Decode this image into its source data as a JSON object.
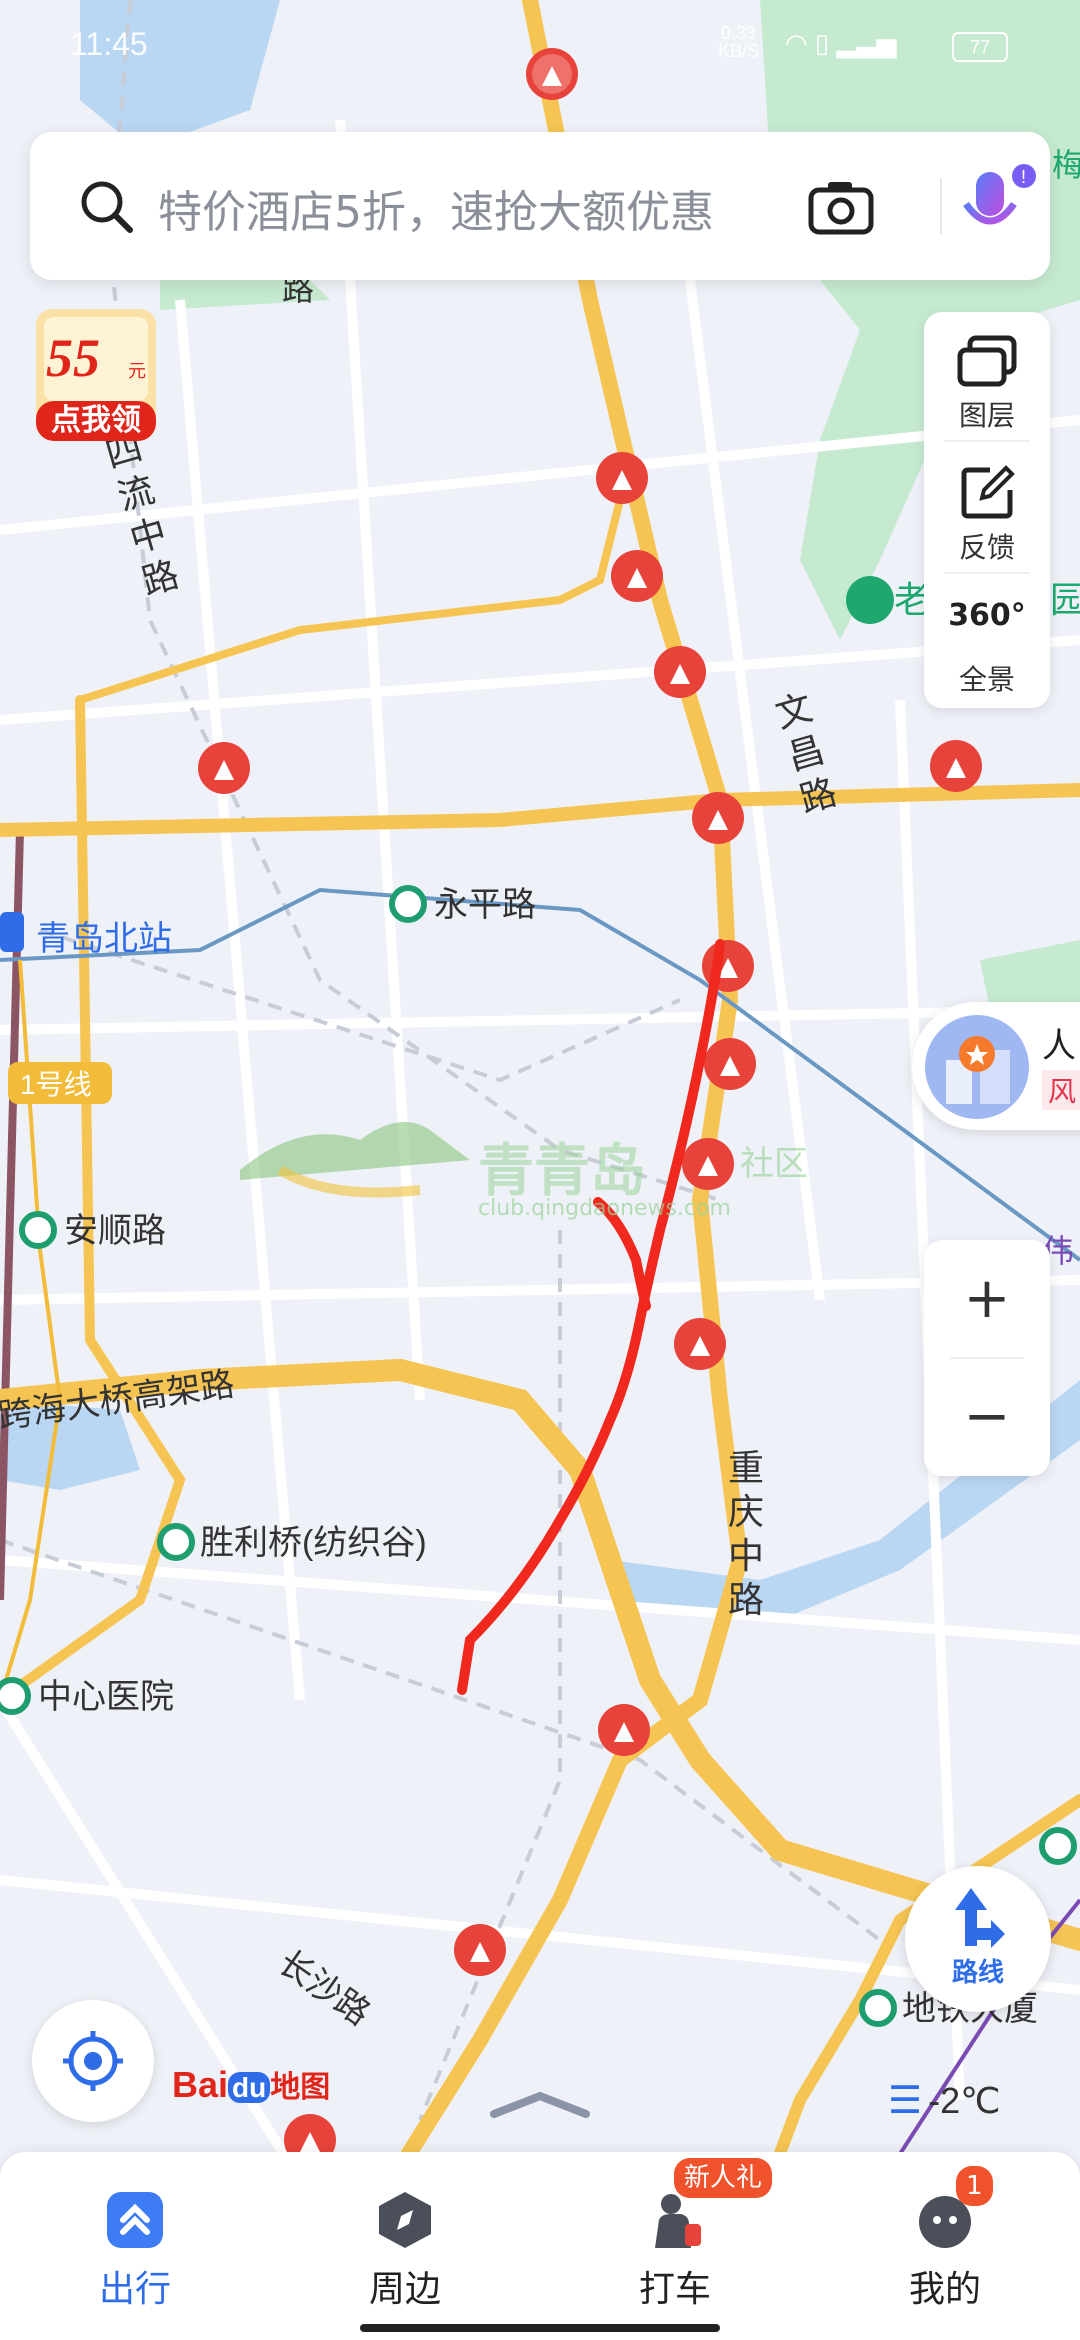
{
  "status_bar": {
    "time": "11:45",
    "net_speed": "0.33",
    "net_unit": "KB/S",
    "battery": "77"
  },
  "search": {
    "placeholder": "特价酒店5折，速抢大额优惠"
  },
  "coupon": {
    "amount": "55",
    "unit": "元",
    "button": "点我领"
  },
  "map_tools": {
    "layers": "图层",
    "feedback": "反馈",
    "panorama_badge": "360°",
    "panorama": "全景"
  },
  "zoom": {
    "in": "+",
    "out": "−"
  },
  "poi_card": {
    "title": "人",
    "tag": "风"
  },
  "map_labels": {
    "roads": [
      "四流中路",
      "文昌路",
      "跨海大桥高架路",
      "重庆中路",
      "长沙路",
      "路",
      "梅",
      "老",
      "园",
      "伟"
    ],
    "stations": [
      "永平路",
      "青岛北站",
      "安顺路",
      "胜利桥(纺织谷)",
      "中心医院",
      "地铁大厦"
    ],
    "line": "1号线"
  },
  "watermark": {
    "title": "青青岛",
    "club": "社区",
    "url": "club.qingdaonews.com"
  },
  "route_button": {
    "label": "路线"
  },
  "brand": {
    "logo_text_a": "Bai",
    "logo_text_b": "du",
    "logo_text_c": "地图"
  },
  "weather": {
    "temp": "-2℃"
  },
  "tabs": [
    {
      "label": "出行",
      "active": true
    },
    {
      "label": "周边",
      "active": false
    },
    {
      "label": "打车",
      "active": false,
      "badge": "新人礼"
    },
    {
      "label": "我的",
      "active": false,
      "badge": "1"
    }
  ],
  "colors": {
    "accent": "#2f6de8",
    "expressway": "#f6c453",
    "construction": "#e8433a",
    "drawn_mark": "#f0281e",
    "park": "#c6ead0",
    "water": "#b9d6f2"
  }
}
